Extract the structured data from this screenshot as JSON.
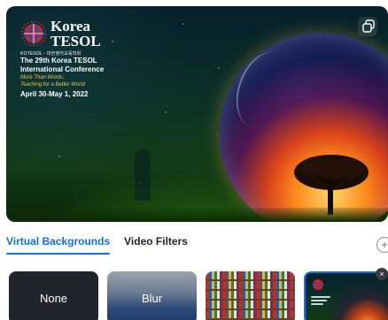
{
  "preview": {
    "brand": {
      "name_line1": "Korea",
      "name_line2": "TESOL",
      "tagline": "KOTESOL - 대한영어교육학회"
    },
    "conference": {
      "line1": "The 29th Korea TESOL",
      "line2": "International Conference",
      "theme_line1": "More Than Words:",
      "theme_line2": "Teaching for a Better World",
      "dates": "April 30-May 1, 2022"
    },
    "icons": {
      "copy": "copy-icon",
      "globe_logo": "globe-logo-icon",
      "tree": "tree-icon"
    }
  },
  "tabs": [
    {
      "label": "Virtual Backgrounds",
      "active": true
    },
    {
      "label": "Video Filters",
      "active": false
    }
  ],
  "add_button": {
    "label": "+",
    "icon": "plus-circle-icon"
  },
  "thumbnails": [
    {
      "label": "None"
    },
    {
      "label": "Blur"
    },
    {
      "label": ""
    },
    {
      "label": ""
    }
  ],
  "close_badge": {
    "label": "×",
    "icon": "close-icon"
  },
  "colors": {
    "accent": "#0e71eb",
    "text": "#232333",
    "highlight": "#f2c744"
  }
}
